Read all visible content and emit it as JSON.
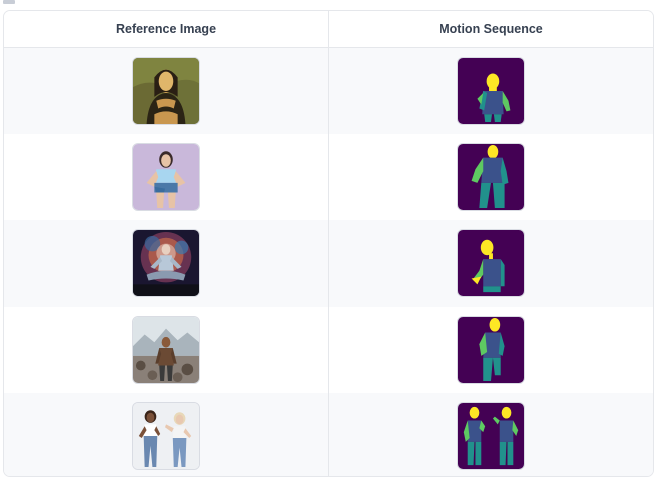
{
  "table": {
    "headers": [
      "Reference Image",
      "Motion Sequence"
    ],
    "rows": [
      {
        "reference": {
          "icon": "mona-lisa-portrait-image"
        },
        "motion": {
          "icon": "single-figure-pose-segmentation-image"
        }
      },
      {
        "reference": {
          "icon": "woman-hands-on-hips-image"
        },
        "motion": {
          "icon": "single-figure-pose-segmentation-image"
        }
      },
      {
        "reference": {
          "icon": "meditating-figure-cosmic-image"
        },
        "motion": {
          "icon": "single-figure-pose-segmentation-image"
        }
      },
      {
        "reference": {
          "icon": "man-standing-mountains-image"
        },
        "motion": {
          "icon": "single-figure-pose-segmentation-image"
        }
      },
      {
        "reference": {
          "icon": "two-women-dancing-image"
        },
        "motion": {
          "icon": "two-figure-pose-segmentation-image"
        }
      }
    ]
  },
  "colors": {
    "header_text": "#374151",
    "border": "#e5e7eb",
    "row_stripe": "#f8f9fb",
    "segmentation_background": "#440154",
    "segmentation_head": "#fde725",
    "segmentation_limb_green": "#5ec962",
    "segmentation_teal": "#21918c",
    "segmentation_body": "#3b528b"
  }
}
